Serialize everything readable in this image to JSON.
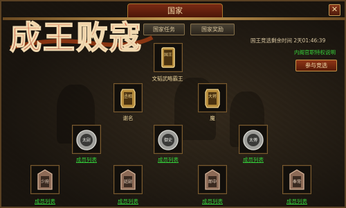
{
  "window": {
    "title": "国家",
    "close_glyph": "✕"
  },
  "banner": {
    "text": "成王败寇"
  },
  "tabs": [
    {
      "label": "国家任务"
    },
    {
      "label": "国家奖励"
    }
  ],
  "countdown": "国王竞选剩余时间 2天01:46:39",
  "privilege_link": "内阁官职特权说明",
  "join_button": "参与竞选",
  "tiers": {
    "king": {
      "badge": "国王",
      "name": "文韬武略霸王"
    },
    "ministers": [
      {
        "badge": "丞相",
        "name": "谢名"
      },
      {
        "badge": "大将",
        "name": "魔"
      }
    ],
    "officials": [
      {
        "badge": "太尉",
        "name": "成员列表"
      },
      {
        "badge": "御史",
        "name": "成员列表"
      },
      {
        "badge": "太傅",
        "name": "成员列表"
      }
    ],
    "juniors": [
      {
        "badge": "少府",
        "name": "成员列表"
      },
      {
        "badge": "廷尉",
        "name": "成员列表"
      },
      {
        "badge": "郎中",
        "name": "成员列表"
      },
      {
        "badge": "奉常",
        "name": "成员列表"
      }
    ]
  },
  "colors": {
    "gold": "#e9d29a",
    "green": "#33cf3a",
    "accent_red": "#8f3517",
    "bronze_tier": "#b48a3a",
    "silver_tier": "#9e9e9a",
    "copper_tier": "#8c6a56"
  }
}
